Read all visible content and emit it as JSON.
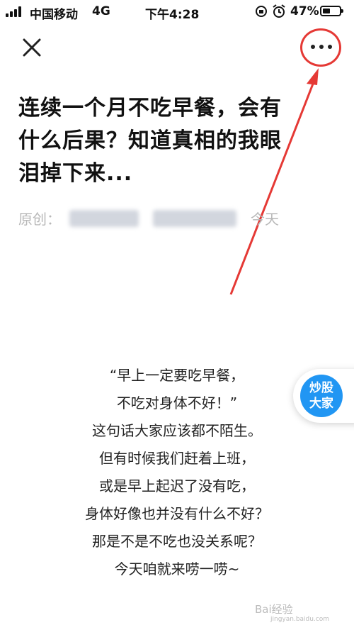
{
  "status_bar": {
    "carrier": "中国移动",
    "network": "4G",
    "time": "下午4:28",
    "battery_percent": "47%",
    "battery_level": 0.47,
    "icons": [
      "lock-rotation-icon",
      "alarm-icon"
    ]
  },
  "nav": {
    "close_icon": "close-icon",
    "more_icon": "more-dots-icon",
    "annotation_color": "#e53935"
  },
  "article": {
    "title_lines": [
      "连续一个月不吃早餐，会有",
      "什么后果？知道真相的我眼",
      "泪掉下来..."
    ],
    "meta_label": "原创：",
    "meta_date": "今天",
    "body_lines": [
      "“早上一定要吃早餐，",
      "  不吃对身体不好！”",
      "这句话大家应该都不陌生。",
      "但有时候我们赶着上班，",
      "或是早上起迟了没有吃，",
      "身体好像也并没有什么不好？",
      "那是不是不吃也没关系呢？",
      "今天咱就来唠一唠~"
    ]
  },
  "badge": {
    "line1": "炒股",
    "line2": "大家",
    "color": "#2196f3"
  },
  "watermark": {
    "text": "Bai经验",
    "sub": "jingyan.baidu.com"
  }
}
